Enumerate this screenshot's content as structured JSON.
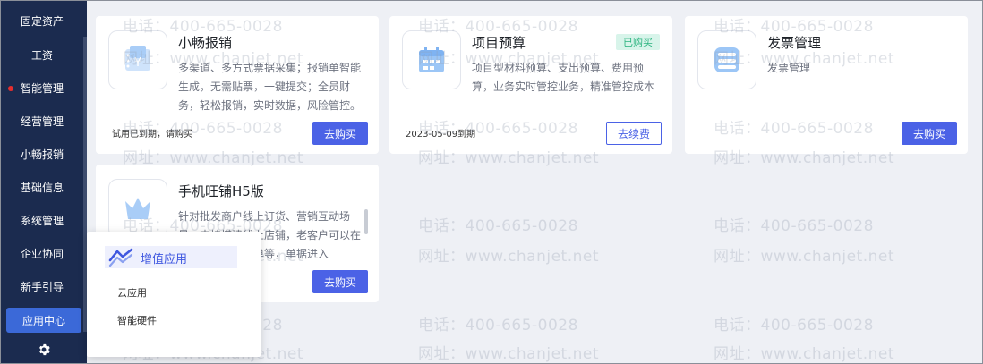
{
  "sidebar": {
    "items": [
      {
        "label": "固定资产"
      },
      {
        "label": "工资"
      },
      {
        "label": "智能管理"
      },
      {
        "label": "经营管理"
      },
      {
        "label": "小畅报销"
      },
      {
        "label": "基础信息"
      },
      {
        "label": "系统管理"
      },
      {
        "label": "企业协同"
      },
      {
        "label": "新手引导"
      },
      {
        "label": "应用中心"
      }
    ],
    "active": "应用中心"
  },
  "cards": [
    {
      "title": "小畅报销",
      "desc": "多渠道、多方式票据采集；报销单智能生成，无需贴票，一键提交；全员财务，轻松报销，实时数据，风险管控。",
      "footer": "试用已到期，请购买",
      "button": "去购买",
      "icon": "receipt-icon"
    },
    {
      "title": "项目预算",
      "desc": "项目型材料预算、支出预算、费用预算，业务实时管控业务，精准管控成本",
      "footer": "2023-05-09到期",
      "button": "去续费",
      "badge": "已购买",
      "icon": "calendar-icon"
    },
    {
      "title": "发票管理",
      "desc": "发票管理",
      "footer": "",
      "button": "去购买",
      "icon": "invoice-icon"
    },
    {
      "title": "手机旺铺H5版",
      "desc": "针对批发商户线上订货、营销互动场景，支持搭建线上店铺，老客户可以在线浏览商品、下单等，单据进入",
      "footer": "",
      "button": "去购买",
      "icon": "crown-icon"
    }
  ],
  "popover": {
    "active": "增值应用",
    "items": [
      "云应用",
      "智能硬件"
    ]
  },
  "watermark": {
    "phone": "电话：400-665-0028",
    "web": "网址：www.chanjet.net"
  },
  "colors": {
    "sidebar_bg": "#1b2b4f",
    "accent": "#4b62e6",
    "badge_green": "#2bb37f"
  }
}
